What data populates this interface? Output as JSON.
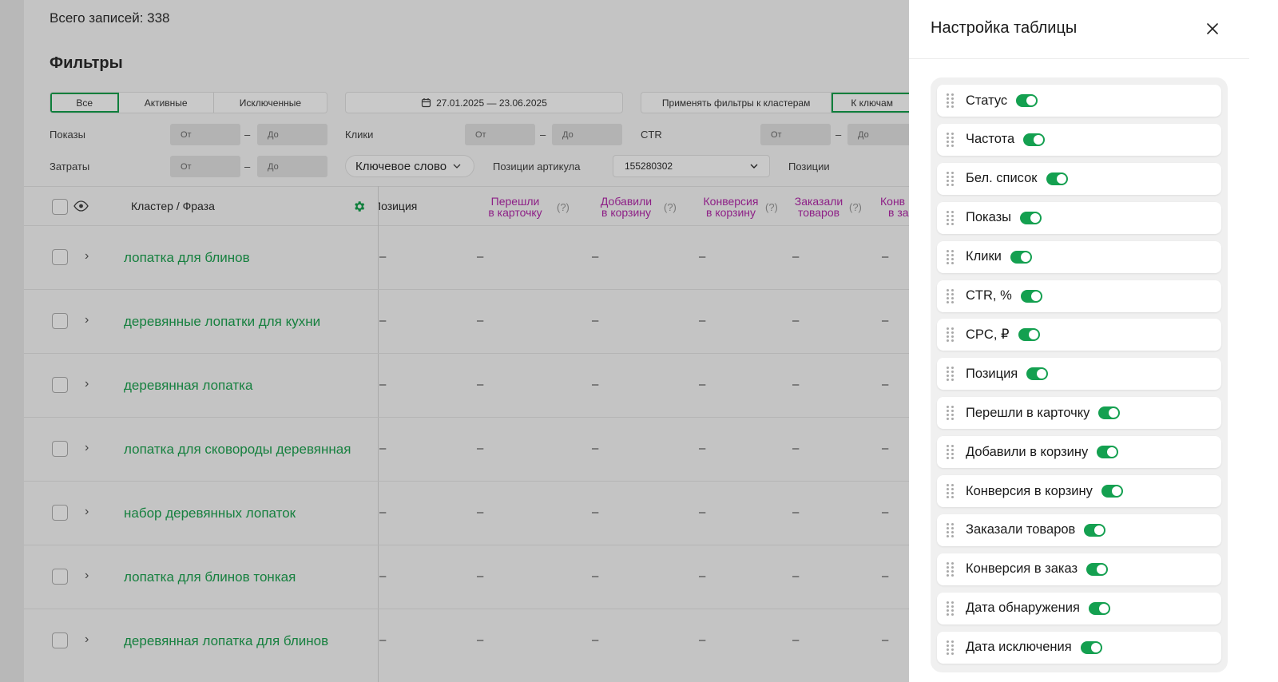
{
  "records": {
    "label": "Всего записей: 338"
  },
  "filters": {
    "title": "Фильтры",
    "status_tabs": [
      "Все",
      "Активные",
      "Исключенные"
    ],
    "date_range": "27.01.2025 — 23.06.2025",
    "apply_tabs": [
      "Применять фильтры к кластерам",
      "К ключам"
    ],
    "shows_label": "Показы",
    "costs_label": "Затраты",
    "clicks_label": "Клики",
    "ctr_label": "CTR",
    "from_placeholder": "От",
    "to_placeholder": "До",
    "dash": "–",
    "keyword_select": "Ключевое слово",
    "article_positions_label": "Позиции артикула",
    "article_value": "155280302",
    "positions_label": "Позиции"
  },
  "table": {
    "header_cluster": "Кластер / Фраза",
    "header_position": "Позиция",
    "header_cols": [
      {
        "line1": "Перешли",
        "line2": "в карточку"
      },
      {
        "line1": "Добавили",
        "line2": "в корзину"
      },
      {
        "line1": "Конверсия",
        "line2": "в корзину"
      },
      {
        "line1": "Заказали",
        "line2": "товаров"
      },
      {
        "line1": "Конв",
        "line2": "в за"
      }
    ],
    "qmark": "(?)",
    "empty": "–",
    "rows": [
      "лопатка для блинов",
      "деревянные лопатки для кухни",
      "деревянная лопатка",
      "лопатка для сковороды деревянная",
      "набор деревянных лопаток",
      "лопатка для блинов тонкая",
      "деревянная лопатка для блинов"
    ]
  },
  "panel": {
    "title": "Настройка таблицы",
    "items": [
      "Статус",
      "Частота",
      "Бел. список",
      "Показы",
      "Клики",
      "CTR, %",
      "CPC, ₽",
      "Позиция",
      "Перешли в карточку",
      "Добавили в корзину",
      "Конверсия в корзину",
      "Заказали товаров",
      "Конверсия в заказ",
      "Дата обнаружения",
      "Дата исключения"
    ]
  },
  "colors": {
    "accent_green": "#14a050",
    "phrase_green": "#16803f",
    "header_magenta": "#8d1f86"
  }
}
